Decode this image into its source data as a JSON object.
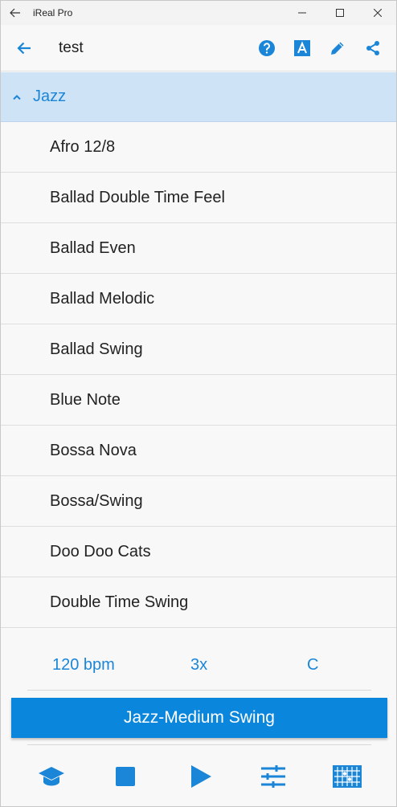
{
  "window": {
    "title": "iReal Pro",
    "back_icon": "arrow-left-icon",
    "controls": [
      "minimize-icon",
      "maximize-icon",
      "close-icon"
    ]
  },
  "appbar": {
    "title": "test",
    "back_icon": "arrow-left-icon",
    "actions": [
      "help-icon",
      "font-icon",
      "edit-icon",
      "share-icon"
    ]
  },
  "group": {
    "label": "Jazz",
    "expanded": true,
    "chevron_icon": "chevron-up-icon"
  },
  "styles": [
    "Afro 12/8",
    "Ballad Double Time Feel",
    "Ballad Even",
    "Ballad Melodic",
    "Ballad Swing",
    "Blue Note",
    "Bossa Nova",
    "Bossa/Swing",
    "Doo Doo Cats",
    "Double Time Swing"
  ],
  "settings": {
    "tempo": "120 bpm",
    "repeats": "3x",
    "key": "C"
  },
  "selected_style": "Jazz-Medium Swing",
  "toolbar": [
    "graduation-cap-icon",
    "stop-icon",
    "play-icon",
    "mixer-sliders-icon",
    "fretboard-icon"
  ],
  "colors": {
    "accent": "#1b86d8",
    "button": "#0b86dd",
    "group_bg": "#cfe3f6",
    "background": "#f8f8f8"
  }
}
